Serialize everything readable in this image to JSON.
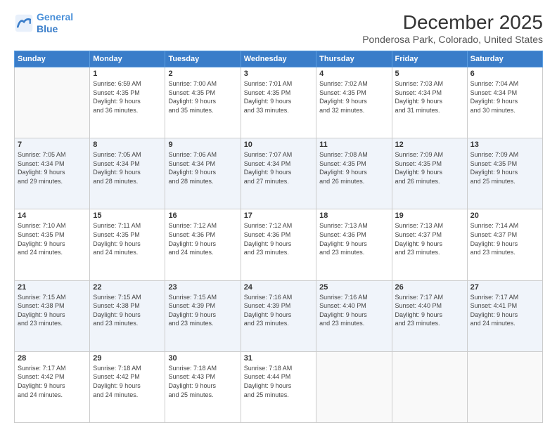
{
  "header": {
    "logo_line1": "General",
    "logo_line2": "Blue",
    "title": "December 2025",
    "subtitle": "Ponderosa Park, Colorado, United States"
  },
  "calendar": {
    "days_header": [
      "Sunday",
      "Monday",
      "Tuesday",
      "Wednesday",
      "Thursday",
      "Friday",
      "Saturday"
    ],
    "weeks": [
      [
        {
          "day": "",
          "info": ""
        },
        {
          "day": "1",
          "info": "Sunrise: 6:59 AM\nSunset: 4:35 PM\nDaylight: 9 hours\nand 36 minutes."
        },
        {
          "day": "2",
          "info": "Sunrise: 7:00 AM\nSunset: 4:35 PM\nDaylight: 9 hours\nand 35 minutes."
        },
        {
          "day": "3",
          "info": "Sunrise: 7:01 AM\nSunset: 4:35 PM\nDaylight: 9 hours\nand 33 minutes."
        },
        {
          "day": "4",
          "info": "Sunrise: 7:02 AM\nSunset: 4:35 PM\nDaylight: 9 hours\nand 32 minutes."
        },
        {
          "day": "5",
          "info": "Sunrise: 7:03 AM\nSunset: 4:34 PM\nDaylight: 9 hours\nand 31 minutes."
        },
        {
          "day": "6",
          "info": "Sunrise: 7:04 AM\nSunset: 4:34 PM\nDaylight: 9 hours\nand 30 minutes."
        }
      ],
      [
        {
          "day": "7",
          "info": "Sunrise: 7:05 AM\nSunset: 4:34 PM\nDaylight: 9 hours\nand 29 minutes."
        },
        {
          "day": "8",
          "info": "Sunrise: 7:05 AM\nSunset: 4:34 PM\nDaylight: 9 hours\nand 28 minutes."
        },
        {
          "day": "9",
          "info": "Sunrise: 7:06 AM\nSunset: 4:34 PM\nDaylight: 9 hours\nand 28 minutes."
        },
        {
          "day": "10",
          "info": "Sunrise: 7:07 AM\nSunset: 4:34 PM\nDaylight: 9 hours\nand 27 minutes."
        },
        {
          "day": "11",
          "info": "Sunrise: 7:08 AM\nSunset: 4:35 PM\nDaylight: 9 hours\nand 26 minutes."
        },
        {
          "day": "12",
          "info": "Sunrise: 7:09 AM\nSunset: 4:35 PM\nDaylight: 9 hours\nand 26 minutes."
        },
        {
          "day": "13",
          "info": "Sunrise: 7:09 AM\nSunset: 4:35 PM\nDaylight: 9 hours\nand 25 minutes."
        }
      ],
      [
        {
          "day": "14",
          "info": "Sunrise: 7:10 AM\nSunset: 4:35 PM\nDaylight: 9 hours\nand 24 minutes."
        },
        {
          "day": "15",
          "info": "Sunrise: 7:11 AM\nSunset: 4:35 PM\nDaylight: 9 hours\nand 24 minutes."
        },
        {
          "day": "16",
          "info": "Sunrise: 7:12 AM\nSunset: 4:36 PM\nDaylight: 9 hours\nand 24 minutes."
        },
        {
          "day": "17",
          "info": "Sunrise: 7:12 AM\nSunset: 4:36 PM\nDaylight: 9 hours\nand 23 minutes."
        },
        {
          "day": "18",
          "info": "Sunrise: 7:13 AM\nSunset: 4:36 PM\nDaylight: 9 hours\nand 23 minutes."
        },
        {
          "day": "19",
          "info": "Sunrise: 7:13 AM\nSunset: 4:37 PM\nDaylight: 9 hours\nand 23 minutes."
        },
        {
          "day": "20",
          "info": "Sunrise: 7:14 AM\nSunset: 4:37 PM\nDaylight: 9 hours\nand 23 minutes."
        }
      ],
      [
        {
          "day": "21",
          "info": "Sunrise: 7:15 AM\nSunset: 4:38 PM\nDaylight: 9 hours\nand 23 minutes."
        },
        {
          "day": "22",
          "info": "Sunrise: 7:15 AM\nSunset: 4:38 PM\nDaylight: 9 hours\nand 23 minutes."
        },
        {
          "day": "23",
          "info": "Sunrise: 7:15 AM\nSunset: 4:39 PM\nDaylight: 9 hours\nand 23 minutes."
        },
        {
          "day": "24",
          "info": "Sunrise: 7:16 AM\nSunset: 4:39 PM\nDaylight: 9 hours\nand 23 minutes."
        },
        {
          "day": "25",
          "info": "Sunrise: 7:16 AM\nSunset: 4:40 PM\nDaylight: 9 hours\nand 23 minutes."
        },
        {
          "day": "26",
          "info": "Sunrise: 7:17 AM\nSunset: 4:40 PM\nDaylight: 9 hours\nand 23 minutes."
        },
        {
          "day": "27",
          "info": "Sunrise: 7:17 AM\nSunset: 4:41 PM\nDaylight: 9 hours\nand 24 minutes."
        }
      ],
      [
        {
          "day": "28",
          "info": "Sunrise: 7:17 AM\nSunset: 4:42 PM\nDaylight: 9 hours\nand 24 minutes."
        },
        {
          "day": "29",
          "info": "Sunrise: 7:18 AM\nSunset: 4:42 PM\nDaylight: 9 hours\nand 24 minutes."
        },
        {
          "day": "30",
          "info": "Sunrise: 7:18 AM\nSunset: 4:43 PM\nDaylight: 9 hours\nand 25 minutes."
        },
        {
          "day": "31",
          "info": "Sunrise: 7:18 AM\nSunset: 4:44 PM\nDaylight: 9 hours\nand 25 minutes."
        },
        {
          "day": "",
          "info": ""
        },
        {
          "day": "",
          "info": ""
        },
        {
          "day": "",
          "info": ""
        }
      ]
    ]
  }
}
